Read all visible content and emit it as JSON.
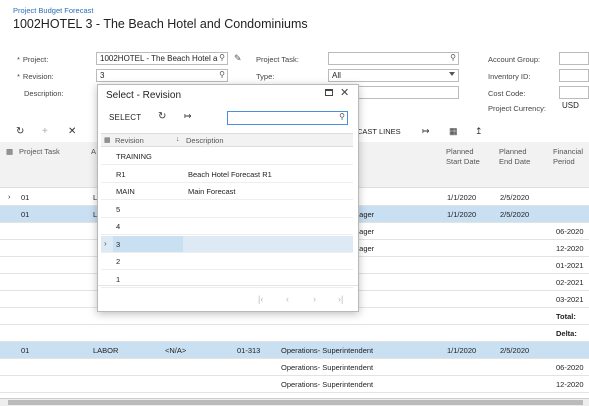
{
  "breadcrumb": "Project Budget Forecast",
  "title": "1002HOTEL 3 - The Beach Hotel and Condominiums",
  "form": {
    "project_label": "Project:",
    "project_value": "1002HOTEL - The Beach Hotel a",
    "revision_label": "Revision:",
    "revision_value": "3",
    "description_label": "Description:",
    "project_task_label": "Project Task:",
    "type_label": "Type:",
    "type_value": "All",
    "account_group_label": "Account Group:",
    "inventory_id_label": "Inventory ID:",
    "cost_code_label": "Cost Code:",
    "project_currency_label": "Project Currency:",
    "project_currency_value": "USD"
  },
  "toolbar": {
    "forecast_lines_label": "ECAST LINES"
  },
  "grid": {
    "headers": {
      "project_task": "Project Task",
      "account_group_partial": "A",
      "planned_start": [
        "Planned",
        "Start Date"
      ],
      "planned_end": [
        "Planned",
        "End Date"
      ],
      "financial_period": [
        "Financial",
        "Period"
      ]
    },
    "rows": [
      {
        "task": "01",
        "acct": "L",
        "desc": "",
        "start": "1/1/2020",
        "end": "2/5/2020",
        "period": "",
        "selected": false,
        "arrow": true
      },
      {
        "task": "01",
        "acct": "L",
        "desc": "nager",
        "start": "1/1/2020",
        "end": "2/5/2020",
        "period": "",
        "selected": true,
        "arrow": false
      },
      {
        "task": "",
        "acct": "",
        "desc": "nager",
        "start": "",
        "end": "",
        "period": "06-2020",
        "selected": false,
        "arrow": false
      },
      {
        "task": "",
        "acct": "",
        "desc": "nager",
        "start": "",
        "end": "",
        "period": "12-2020",
        "selected": false,
        "arrow": false
      },
      {
        "task": "",
        "acct": "",
        "desc": "",
        "start": "",
        "end": "",
        "period": "01-2021",
        "selected": false,
        "arrow": false
      },
      {
        "task": "",
        "acct": "",
        "desc": "",
        "start": "",
        "end": "",
        "period": "02-2021",
        "selected": false,
        "arrow": false
      },
      {
        "task": "",
        "acct": "",
        "desc": "",
        "start": "",
        "end": "",
        "period": "03-2021",
        "selected": false,
        "arrow": false
      },
      {
        "task": "",
        "acct": "",
        "desc": "",
        "start": "",
        "end": "",
        "period": "Total:",
        "selected": false,
        "arrow": false,
        "bold": true
      },
      {
        "task": "",
        "acct": "",
        "desc": "",
        "start": "",
        "end": "",
        "period": "Delta:",
        "selected": false,
        "arrow": false,
        "bold": true
      },
      {
        "task": "01",
        "acct": "LABOR",
        "inv": "<N/A>",
        "code": "01-313",
        "desc": "Operations- Superintendent",
        "start": "1/1/2020",
        "end": "2/5/2020",
        "period": "",
        "selected": true,
        "arrow": false
      },
      {
        "task": "",
        "acct": "",
        "desc": "Operations- Superintendent",
        "start": "",
        "end": "",
        "period": "06-2020",
        "selected": false,
        "arrow": false
      },
      {
        "task": "",
        "acct": "",
        "desc": "Operations- Superintendent",
        "start": "",
        "end": "",
        "period": "12-2020",
        "selected": false,
        "arrow": false
      }
    ]
  },
  "dialog": {
    "title": "Select - Revision",
    "select_label": "SELECT",
    "col_revision": "Revision",
    "col_description": "Description",
    "rows": [
      {
        "revision": "TRAINING",
        "description": "",
        "selected": false
      },
      {
        "revision": "R1",
        "description": "Beach Hotel Forecast R1",
        "selected": false
      },
      {
        "revision": "MAIN",
        "description": "Main Forecast",
        "selected": false
      },
      {
        "revision": "5",
        "description": "",
        "selected": false
      },
      {
        "revision": "4",
        "description": "",
        "selected": false
      },
      {
        "revision": "3",
        "description": "",
        "selected": true
      },
      {
        "revision": "2",
        "description": "",
        "selected": false
      },
      {
        "revision": "1",
        "description": "",
        "selected": false
      }
    ]
  }
}
